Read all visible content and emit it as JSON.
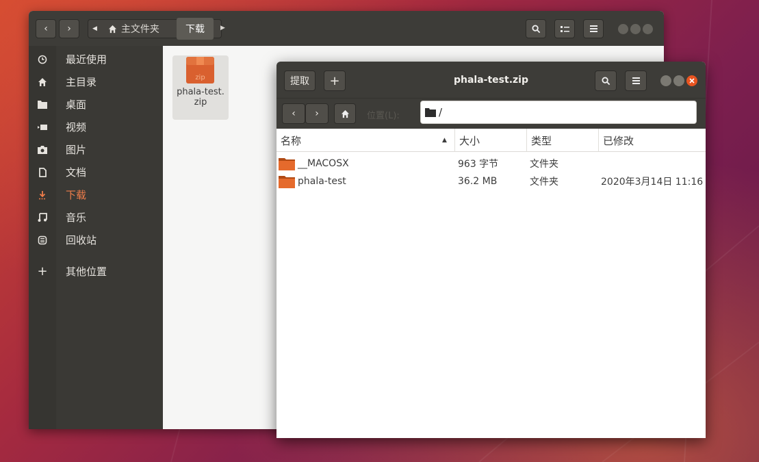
{
  "nautilus": {
    "breadcrumb_home": "主文件夹",
    "breadcrumb_current": "下载",
    "sidebar": [
      {
        "label": "最近使用",
        "icon": "clock-icon"
      },
      {
        "label": "主目录",
        "icon": "home-icon"
      },
      {
        "label": "桌面",
        "icon": "desktop-folder-icon"
      },
      {
        "label": "视频",
        "icon": "video-icon"
      },
      {
        "label": "图片",
        "icon": "camera-icon"
      },
      {
        "label": "文档",
        "icon": "document-icon"
      },
      {
        "label": "下载",
        "icon": "download-icon",
        "active": true
      },
      {
        "label": "音乐",
        "icon": "music-icon"
      },
      {
        "label": "回收站",
        "icon": "trash-icon"
      }
    ],
    "other_locations": "其他位置",
    "file": {
      "name_line1": "phala-test.",
      "name_line2": "zip",
      "icon_text": "zip"
    }
  },
  "archive_manager": {
    "title": "phala-test.zip",
    "extract_label": "提取",
    "add_label": "+",
    "location_label": "位置(L):",
    "path": "/",
    "columns": {
      "name": "名称",
      "size": "大小",
      "type": "类型",
      "modified": "已修改"
    },
    "rows": [
      {
        "name": "__MACOSX",
        "size": "963 字节",
        "type": "文件夹",
        "modified": ""
      },
      {
        "name": "phala-test",
        "size": "36.2 MB",
        "type": "文件夹",
        "modified": "2020年3月14日 11:16"
      }
    ]
  },
  "colors": {
    "accent": "#e95420",
    "header": "#3d3c38",
    "sidebar": "#3a3935"
  }
}
